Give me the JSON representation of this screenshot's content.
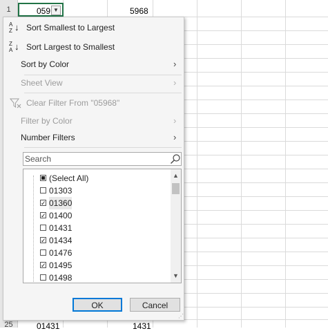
{
  "sheet": {
    "row1_num": "1",
    "row25_num": "25",
    "a1_value": "059",
    "b1_value": "5968",
    "a25_value": "01431",
    "b25_value": "1431"
  },
  "sort": {
    "asc_label": "Sort Smallest to Largest",
    "desc_label": "Sort Largest to Smallest",
    "asc_icon_top": "A",
    "asc_icon_bottom": "Z",
    "desc_icon_top": "Z",
    "desc_icon_bottom": "A"
  },
  "menu": {
    "sort_by_color": "Sort by Color",
    "sheet_view": "Sheet View",
    "clear_filter": "Clear Filter From \"05968\"",
    "filter_by_color": "Filter by Color",
    "number_filters": "Number Filters"
  },
  "search": {
    "placeholder": "Search"
  },
  "list": {
    "items": [
      {
        "label": "(Select All)",
        "state": "partial"
      },
      {
        "label": "01303",
        "state": "unchecked"
      },
      {
        "label": "01360",
        "state": "checked"
      },
      {
        "label": "01400",
        "state": "checked"
      },
      {
        "label": "01431",
        "state": "unchecked"
      },
      {
        "label": "01434",
        "state": "checked"
      },
      {
        "label": "01476",
        "state": "unchecked"
      },
      {
        "label": "01495",
        "state": "checked"
      },
      {
        "label": "01498",
        "state": "unchecked"
      }
    ]
  },
  "buttons": {
    "ok": "OK",
    "cancel": "Cancel"
  },
  "colors": {
    "accent": "#217346",
    "focus": "#0078d7"
  }
}
